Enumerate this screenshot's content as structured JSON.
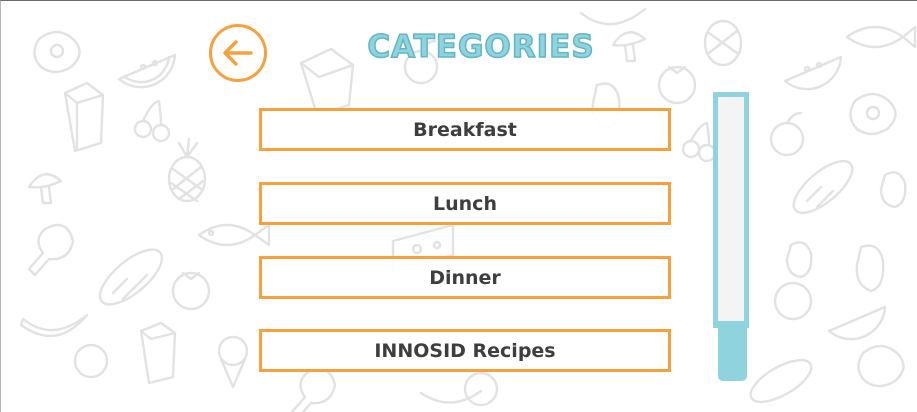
{
  "header": {
    "title": "CATEGORIES",
    "back_icon": "arrow-left-icon"
  },
  "categories": [
    {
      "label": "Breakfast"
    },
    {
      "label": "Lunch"
    },
    {
      "label": "Dinner"
    },
    {
      "label": "INNOSID Recipes"
    }
  ],
  "scrollbar": {
    "position_fraction": 1.0
  },
  "colors": {
    "accent_orange": "#f7a03c",
    "accent_teal": "#8fd3de",
    "text_dark": "#3e3e3e",
    "doodle_gray": "#e2e2e2"
  },
  "background": {
    "pattern": "food-doodles",
    "icons": [
      "steak-icon",
      "watermelon-icon",
      "milk-carton-icon",
      "cherry-icon",
      "pineapple-icon",
      "mushroom-icon",
      "drumstick-icon",
      "baguette-icon",
      "tomato-icon",
      "fish-icon",
      "banana-icon",
      "cheese-icon",
      "ice-cream-icon",
      "pepper-icon",
      "eggplant-icon",
      "apple-icon"
    ]
  }
}
